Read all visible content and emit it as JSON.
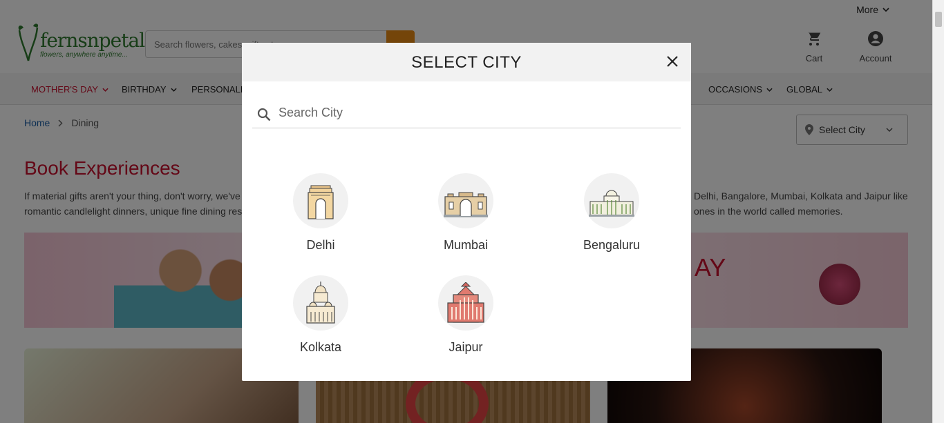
{
  "topbar": {
    "more_label": "More"
  },
  "header": {
    "logo_brand": "fernsnpetals",
    "logo_tagline": "flowers, anywhere anytime...",
    "search_placeholder": "Search flowers, cakes, gifts etc.",
    "cart_label": "Cart",
    "account_label": "Account"
  },
  "nav": {
    "items": [
      {
        "label": "MOTHER'S DAY"
      },
      {
        "label": "BIRTHDAY"
      },
      {
        "label": "PERSONALIS"
      },
      {
        "label": "OCCASIONS"
      },
      {
        "label": "GLOBAL"
      }
    ]
  },
  "breadcrumb": {
    "home": "Home",
    "current": "Dining"
  },
  "city_selector": {
    "label": "Select City"
  },
  "page": {
    "title": "Book Experiences",
    "desc_line1_left": "If material gifts aren't your thing, don't worry, we've",
    "desc_line1_right": "Delhi, Bangalore, Mumbai, Kolkata and Jaipur like",
    "desc_line2_left": "romantic candlelight dinners, unique fine dining res",
    "desc_line2_right": "ones in the world called memories.",
    "banner_text": "AY"
  },
  "modal": {
    "title": "SELECT CITY",
    "search_placeholder": "Search City",
    "cities": [
      {
        "name": "Delhi",
        "icon": "india-gate-icon"
      },
      {
        "name": "Mumbai",
        "icon": "gateway-of-india-icon"
      },
      {
        "name": "Bengaluru",
        "icon": "vidhana-soudha-icon"
      },
      {
        "name": "Kolkata",
        "icon": "victoria-memorial-icon"
      },
      {
        "name": "Jaipur",
        "icon": "hawa-mahal-icon"
      }
    ]
  },
  "colors": {
    "brand_green": "#2f7a2f",
    "accent_red": "#c8102e",
    "search_orange": "#e98a15",
    "link_blue": "#1b5ea6"
  }
}
